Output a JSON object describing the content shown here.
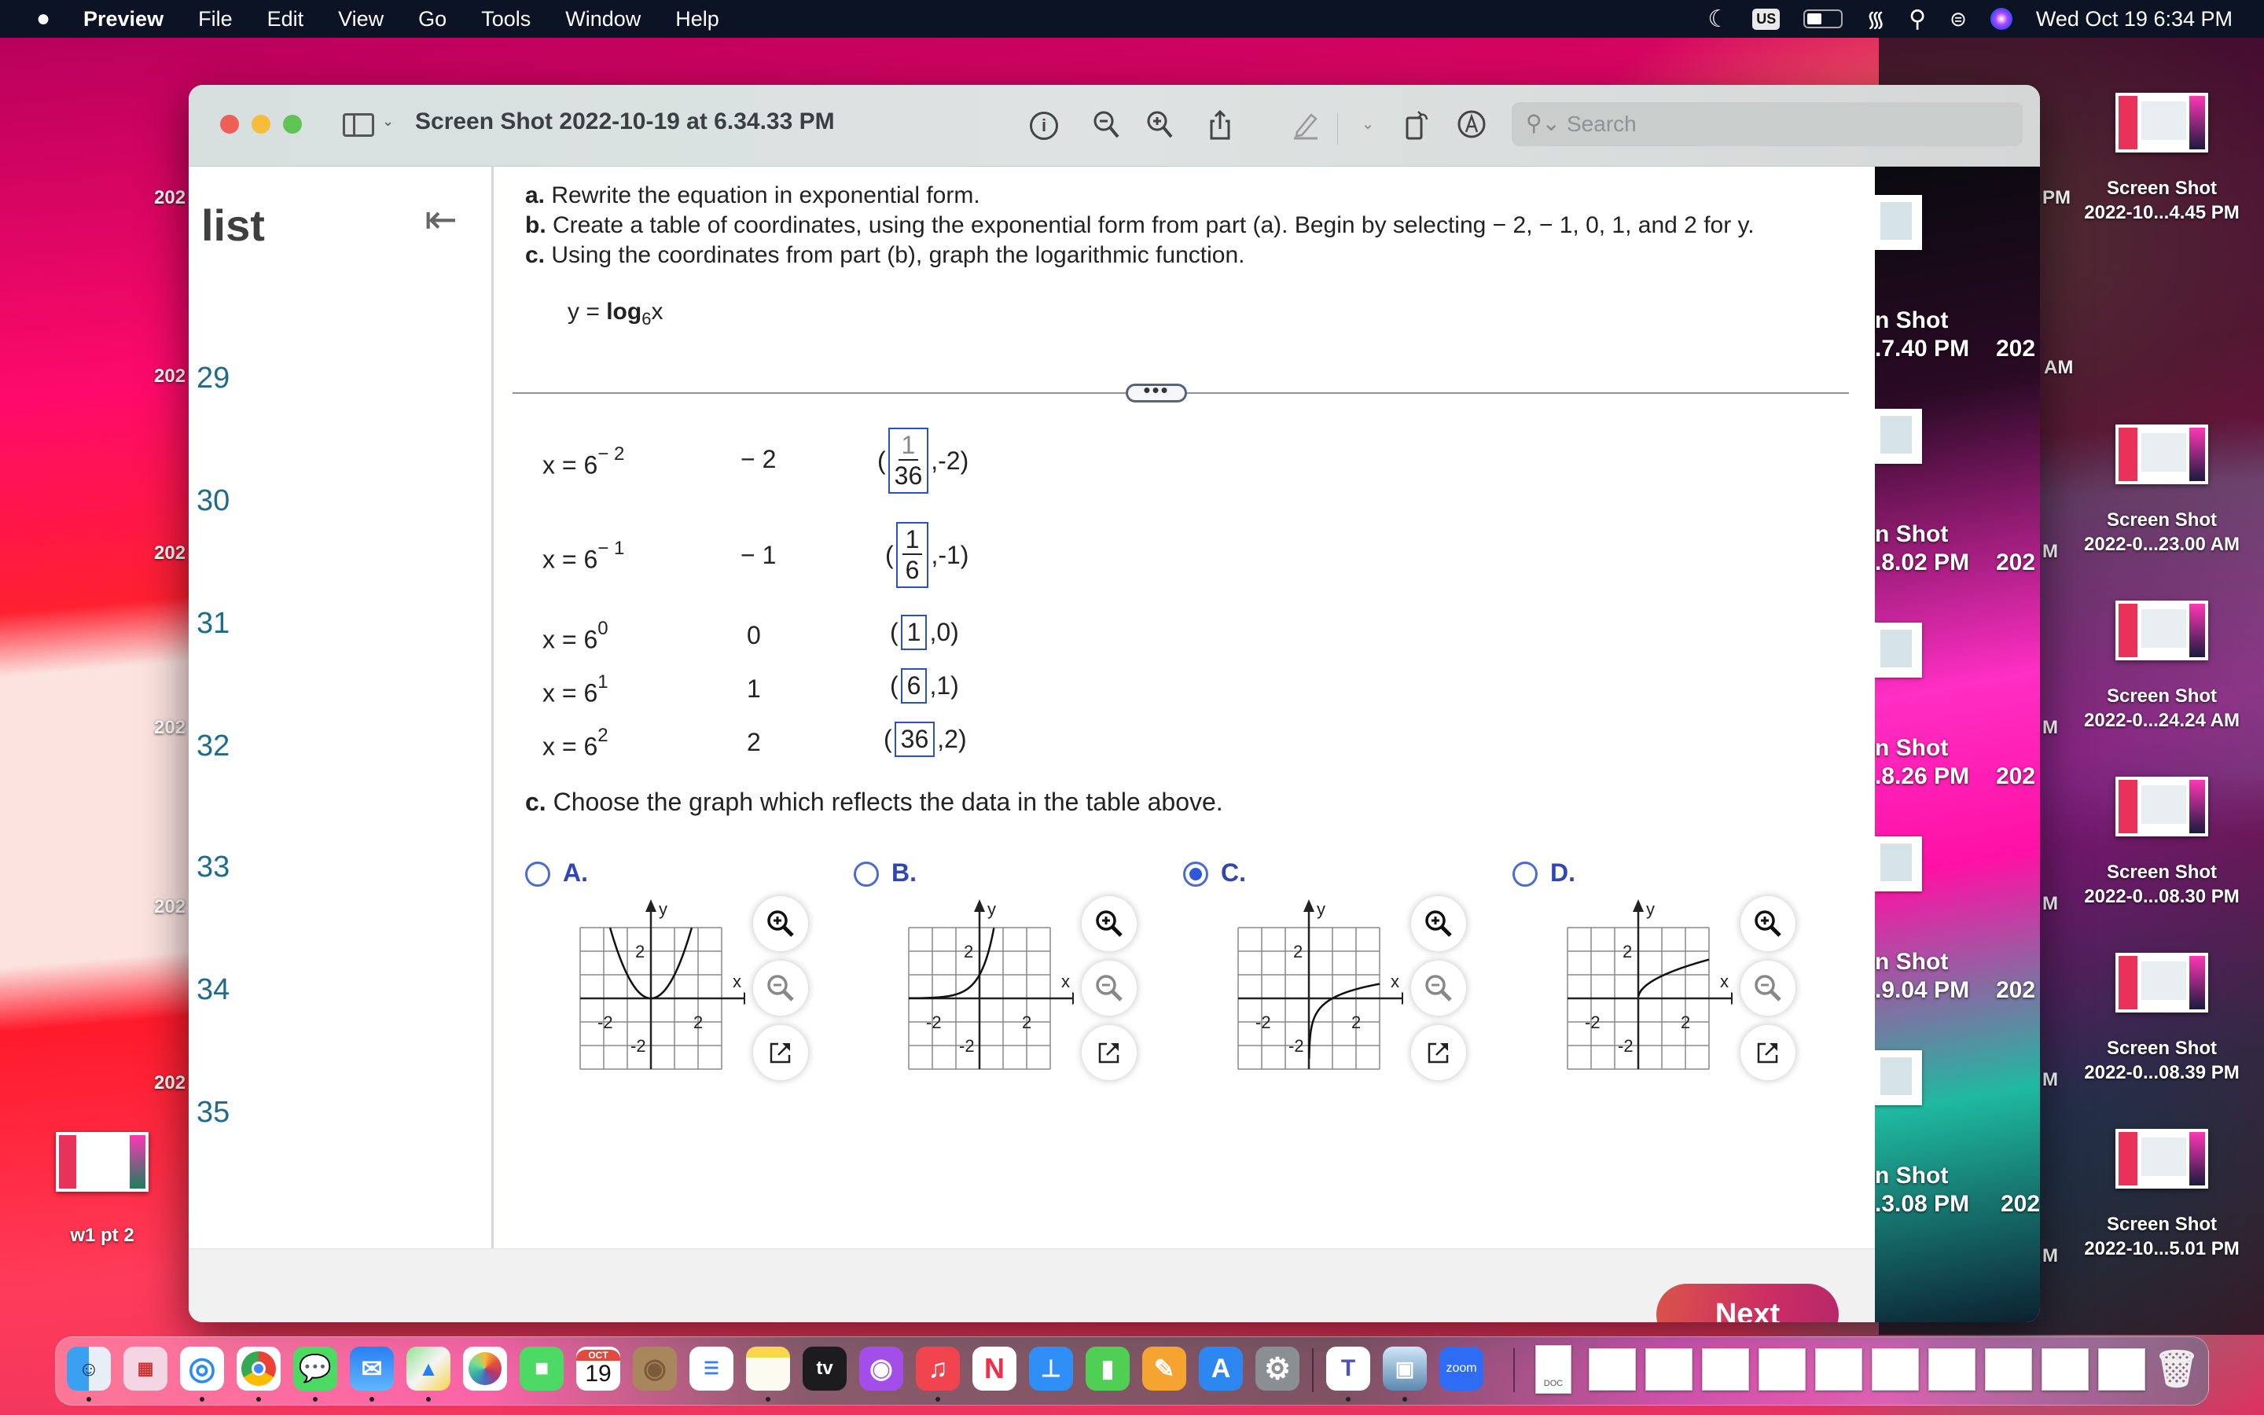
{
  "menubar": {
    "apple": "",
    "app_name": "Preview",
    "items": [
      "File",
      "Edit",
      "View",
      "Go",
      "Tools",
      "Window",
      "Help"
    ],
    "input_source": "US",
    "datetime": "Wed Oct 19  6:34 PM"
  },
  "window": {
    "title": "Screen Shot 2022-10-19 at 6.34.33 PM",
    "search_placeholder": "Search",
    "toolbar": [
      "info",
      "zoom-out",
      "zoom-in",
      "share",
      "markup",
      "rotate",
      "annotate"
    ]
  },
  "sidebar": {
    "title": "list",
    "items": [
      "29",
      "30",
      "31",
      "32",
      "33",
      "34",
      "35"
    ]
  },
  "question": {
    "part_a_label": "a.",
    "part_a": " Rewrite the equation in exponential form.",
    "part_b_label": "b.",
    "part_b": " Create a table of coordinates, using the exponential form from part (a). Begin by selecting  − 2,  − 1, 0, 1, and 2 for y.",
    "part_c_label": "c.",
    "part_c": "  Using the coordinates from part (b), graph the logarithmic function.",
    "equation_prefix": "y = ",
    "equation_log": "log",
    "equation_base": "6",
    "equation_arg": "x"
  },
  "table": {
    "rows": [
      {
        "x_expr_base": "x  = 6",
        "x_expr_exp": "− 2",
        "y": "− 2",
        "x_num": "1",
        "x_den": "36",
        "y_coord": ",-2)"
      },
      {
        "x_expr_base": "x  = 6",
        "x_expr_exp": "− 1",
        "y": "− 1",
        "x_num": "1",
        "x_den": "6",
        "y_coord": ",-1)"
      },
      {
        "x_expr_base": "x  = 6",
        "x_expr_exp": "0",
        "y": "0",
        "x_value": "1",
        "y_coord": ",0)"
      },
      {
        "x_expr_base": "x  = 6",
        "x_expr_exp": "1",
        "y": "1",
        "x_value": "6",
        "y_coord": ",1)"
      },
      {
        "x_expr_base": "x  = 6",
        "x_expr_exp": "2",
        "y": "2",
        "x_value": "36",
        "y_coord": ",2)"
      }
    ],
    "open_paren": "("
  },
  "choice": {
    "prompt_label": "c.",
    "prompt": "  Choose the graph which reflects the data in the table above.",
    "selected": "C",
    "options": [
      {
        "letter": "A.",
        "curve": "parabola y = x^2"
      },
      {
        "letter": "B.",
        "curve": "exponential y = 6^x"
      },
      {
        "letter": "C.",
        "curve": "logarithmic y = log6 x"
      },
      {
        "letter": "D.",
        "curve": "square-root-like y = sqrt(x)"
      }
    ],
    "graph_labels": {
      "x": "x",
      "y": "y",
      "tick_pos": "2",
      "tick_neg": "-2"
    }
  },
  "next_button": "Next",
  "desktop": {
    "right_column": [
      {
        "line1": "Screen Shot",
        "line2": "2022-10...4.45 PM"
      },
      {
        "line1": "Screen Shot",
        "line2": "2022-0...23.00 AM"
      },
      {
        "line1": "Screen Shot",
        "line2": "2022-0...24.24 AM"
      },
      {
        "line1": "Screen Shot",
        "line2": "2022-0...08.30 PM"
      },
      {
        "line1": "Screen Shot",
        "line2": "2022-0...08.39 PM"
      },
      {
        "line1": "Screen Shot",
        "line2": "2022-10...5.01 PM"
      }
    ],
    "strip_column": [
      {
        "line1": "n Shot",
        "line2": ".7.40 PM"
      },
      {
        "line1": "n Shot",
        "line2": ".8.02 PM"
      },
      {
        "line1": "n Shot",
        "line2": ".8.26 PM"
      },
      {
        "line1": "n Shot",
        "line2": ".9.04 PM"
      },
      {
        "line1": "n Shot",
        "line2": ".3.08 PM"
      }
    ],
    "strip_partial": [
      "202",
      "202",
      "202",
      "202",
      "202"
    ],
    "partial_pm": "PM",
    "partial_am": "AM",
    "partial_m": "M",
    "left_edge_partial": "202",
    "left_icon_label": "w1 pt 2"
  },
  "dock": {
    "apps": [
      "Finder",
      "Launchpad",
      "Safari",
      "Chrome",
      "Messages",
      "Mail",
      "Maps",
      "Photos",
      "FaceTime",
      "Calendar",
      "Contacts",
      "Reminders",
      "Notes",
      "TV",
      "Podcasts",
      "Music",
      "News",
      "Keynote",
      "Numbers",
      "Pages",
      "App Store",
      "System Preferences",
      "Teams",
      "Preview",
      "Zoom"
    ],
    "calendar_month": "OCT",
    "calendar_day": "19",
    "tv_label": "tv",
    "zoom_label": "zoom",
    "doc_label": "DOC"
  }
}
